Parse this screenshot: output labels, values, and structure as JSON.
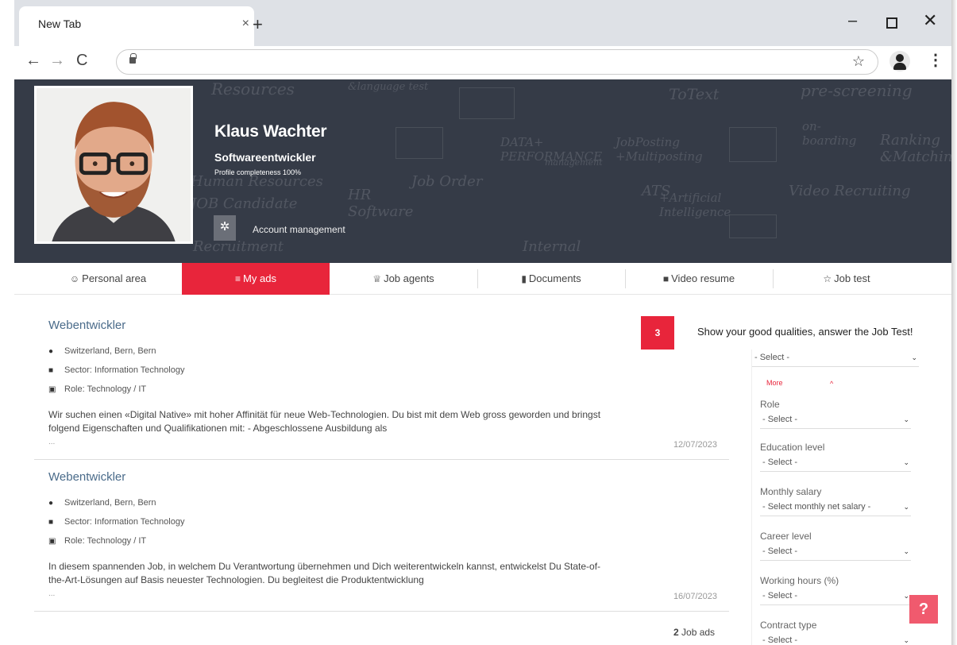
{
  "browser": {
    "tab_title": "New Tab",
    "tab_close": "×",
    "new_tab": "+",
    "minimize": "–",
    "close": "✕",
    "back": "←",
    "forward": "→",
    "reload": "C",
    "bookmark_star": "☆",
    "menu": "⋮"
  },
  "profile": {
    "name": "Klaus Wachter",
    "title": "Softwareentwickler",
    "completeness": "Profile completeness 100%",
    "gear": "✲",
    "account_link": "Account management"
  },
  "hero_doodles": [
    "Resources",
    "&language test",
    "pre-screening",
    "ToText",
    "DATA+ PERFORMANCE",
    "management",
    "JobPosting +Multiposting",
    "on- boarding",
    "Ranking &Matching",
    "Human Resources",
    "JOB Candidate",
    "HR Software",
    "Job Order",
    "ATS",
    "+Artificial Intelligence",
    "Video Recruiting",
    "Internal",
    "Recruitment"
  ],
  "nav": {
    "items": [
      {
        "icon": "☺",
        "label": "Personal area"
      },
      {
        "icon": "≡",
        "label": "My ads"
      },
      {
        "icon": "♕",
        "label": "Job agents"
      },
      {
        "icon": "▮",
        "label": "Documents"
      },
      {
        "icon": "■",
        "label": "Video resume"
      },
      {
        "icon": "☆",
        "label": "Job test"
      }
    ]
  },
  "ads": [
    {
      "title": "Webentwickler",
      "location": "Switzerland, Bern, Bern",
      "sector": "Sector: Information Technology",
      "role": "Role: Technology / IT",
      "desc": "Wir suchen einen «Digital Native» mit hoher Affinität für neue Web-Technologien. Du bist mit dem Web gross geworden und bringst folgend Eigenschaften und Qualifikationen mit: - Abgeschlossene Ausbildung als",
      "ellipsis": "...",
      "date": "12/07/2023"
    },
    {
      "title": "Webentwickler",
      "location": "Switzerland, Bern, Bern",
      "sector": "Sector: Information Technology",
      "role": "Role: Technology / IT",
      "desc": "In diesem spannenden Job, in welchem Du Verantwortung übernehmen und Dich weiterentwickeln kannst, entwickelst Du State-of-the-Art-Lösungen auf Basis neuester Technologien. Du begleitest die Produktentwicklung",
      "ellipsis": "...",
      "date": "16/07/2023"
    }
  ],
  "ads_count": {
    "number": "2",
    "label": "Job ads"
  },
  "jobtest": {
    "badge": "3",
    "text": "Show your good qualities, answer the Job Test!"
  },
  "filters": {
    "first_select": "- Select -",
    "more": "More",
    "more_chevron": "^",
    "fields": [
      {
        "label": "Role",
        "value": "- Select -"
      },
      {
        "label": "Education level",
        "value": "- Select -"
      },
      {
        "label": "Monthly salary",
        "value": "- Select monthly net salary -"
      },
      {
        "label": "Career level",
        "value": "- Select -"
      },
      {
        "label": "Working hours (%)",
        "value": "- Select -"
      },
      {
        "label": "Contract type",
        "value": "- Select -"
      }
    ],
    "chevron": "⌄"
  },
  "help": "?",
  "icons": [
    "map-pin-icon",
    "briefcase-icon",
    "id-card-icon",
    "gear-icon",
    "lock-icon",
    "star-icon",
    "user-avatar-icon"
  ]
}
